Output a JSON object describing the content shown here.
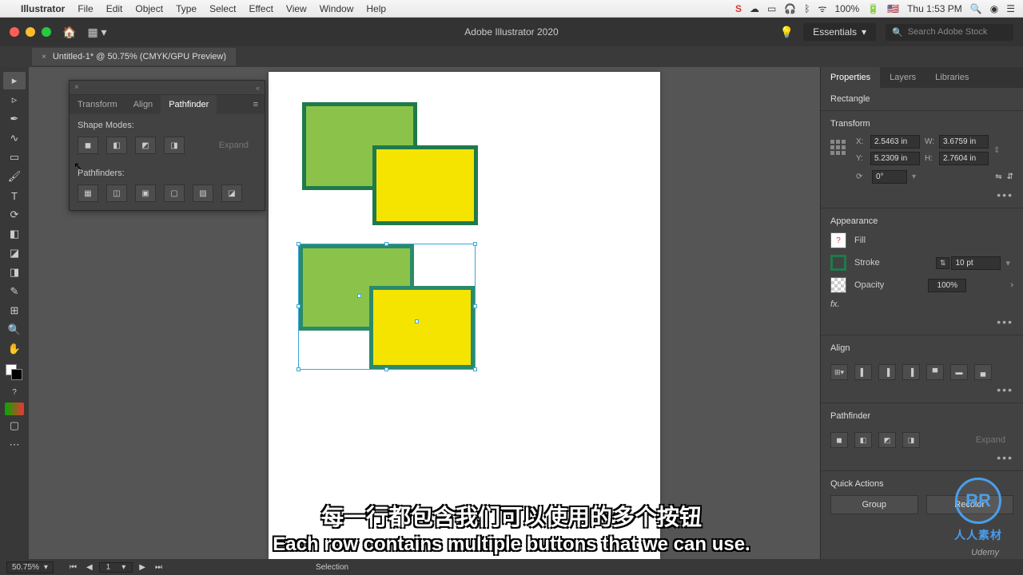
{
  "mac_menu": {
    "app": "Illustrator",
    "items": [
      "File",
      "Edit",
      "Object",
      "Type",
      "Select",
      "Effect",
      "View",
      "Window",
      "Help"
    ],
    "right": {
      "battery": "100%",
      "clock": "Thu 1:53 PM"
    }
  },
  "topbar": {
    "title": "Adobe Illustrator 2020",
    "workspace": "Essentials",
    "search_placeholder": "Search Adobe Stock"
  },
  "doc_tab": "Untitled-1* @ 50.75% (CMYK/GPU Preview)",
  "pathfinder_panel": {
    "tabs": [
      "Transform",
      "Align",
      "Pathfinder"
    ],
    "section1": "Shape Modes:",
    "section2": "Pathfinders:",
    "expand": "Expand"
  },
  "right_panel": {
    "tabs": [
      "Properties",
      "Layers",
      "Libraries"
    ],
    "selection_type": "Rectangle",
    "transform": {
      "hdr": "Transform",
      "x": "2.5463 in",
      "y": "5.2309 in",
      "w": "3.6759 in",
      "h": "2.7604 in",
      "angle": "0°"
    },
    "appearance": {
      "hdr": "Appearance",
      "fill_lbl": "Fill",
      "stroke_lbl": "Stroke",
      "stroke_val": "10 pt",
      "opacity_lbl": "Opacity",
      "opacity_val": "100%",
      "fx": "fx."
    },
    "align_hdr": "Align",
    "pathfinder_hdr": "Pathfinder",
    "pf_expand": "Expand",
    "quick_actions": {
      "hdr": "Quick Actions",
      "group": "Group",
      "recolor": "Recolor"
    }
  },
  "status": {
    "zoom": "50.75%",
    "page": "1",
    "tool": "Selection"
  },
  "subtitle": {
    "zh": "每一行都包含我们可以使用的多个按钮",
    "en": "Each row contains multiple buttons that we can use."
  },
  "watermark": {
    "text": "人人素材",
    "udemy": "Udemy"
  }
}
